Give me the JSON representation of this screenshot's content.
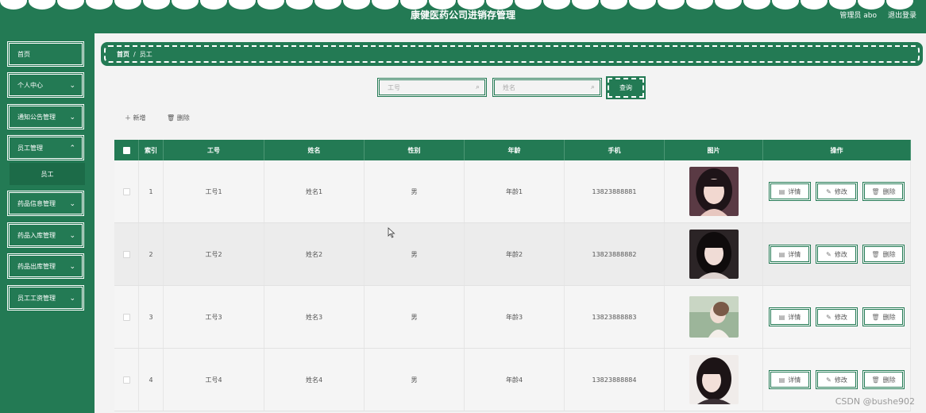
{
  "header": {
    "title": "康健医药公司进销存管理",
    "user": "管理员 abo",
    "logout": "退出登录"
  },
  "sidebar": {
    "items": [
      {
        "label": "首页",
        "expandable": false
      },
      {
        "label": "个人中心",
        "expandable": true
      },
      {
        "label": "通知公告管理",
        "expandable": true
      },
      {
        "label": "员工管理",
        "expandable": true
      },
      {
        "label": "药品信息管理",
        "expandable": true
      },
      {
        "label": "药品入库管理",
        "expandable": true
      },
      {
        "label": "药品出库管理",
        "expandable": true
      },
      {
        "label": "员工工资管理",
        "expandable": true
      }
    ],
    "sub_item": "员工"
  },
  "breadcrumb": {
    "home": "首页",
    "separator": "/",
    "current": "员工"
  },
  "search": {
    "id_placeholder": "工号",
    "name_placeholder": "姓名",
    "button": "查询"
  },
  "actions": {
    "add": "新增",
    "delete": "删除"
  },
  "table": {
    "headers": [
      "",
      "索引",
      "工号",
      "姓名",
      "性别",
      "年龄",
      "手机",
      "图片",
      "操作"
    ],
    "rows": [
      {
        "index": "1",
        "id": "工号1",
        "name": "姓名1",
        "gender": "男",
        "age": "年龄1",
        "phone": "13823888881"
      },
      {
        "index": "2",
        "id": "工号2",
        "name": "姓名2",
        "gender": "男",
        "age": "年龄2",
        "phone": "13823888882"
      },
      {
        "index": "3",
        "id": "工号3",
        "name": "姓名3",
        "gender": "男",
        "age": "年龄3",
        "phone": "13823888883"
      },
      {
        "index": "4",
        "id": "工号4",
        "name": "姓名4",
        "gender": "男",
        "age": "年龄4",
        "phone": "13823888884"
      }
    ],
    "ops": {
      "detail": "详情",
      "edit": "修改",
      "delete": "删除"
    }
  },
  "watermark": "CSDN @bushe902",
  "colors": {
    "primary": "#237a54",
    "background": "#f3f3f3"
  }
}
